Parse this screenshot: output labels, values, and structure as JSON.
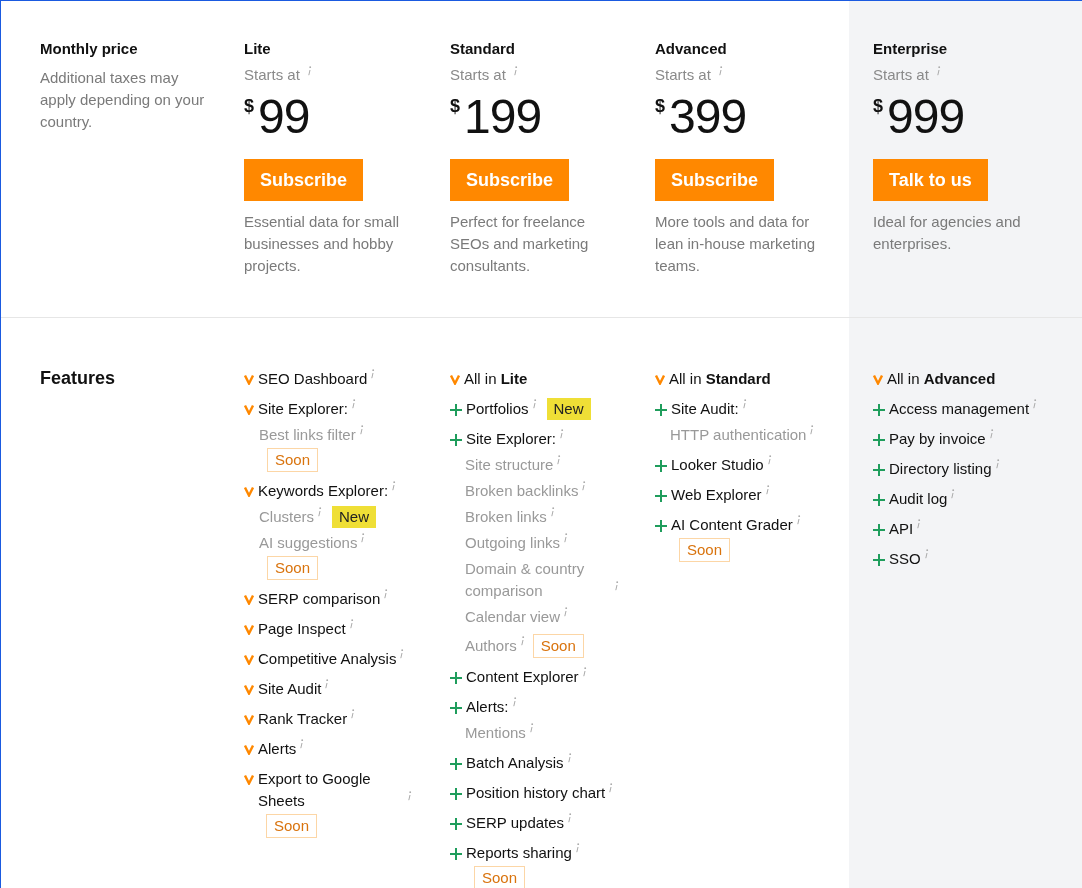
{
  "pricing": {
    "title": "Monthly price",
    "note": "Additional taxes may apply depending on your country.",
    "plans": [
      {
        "name": "Lite",
        "starts_at": "Starts at",
        "currency": "$",
        "price": "99",
        "button": "Subscribe",
        "description": "Essential data for small businesses and hobby projects.",
        "highlighted": false
      },
      {
        "name": "Standard",
        "starts_at": "Starts at",
        "currency": "$",
        "price": "199",
        "button": "Subscribe",
        "description": "Perfect for freelance SEOs and marketing consultants.",
        "highlighted": false
      },
      {
        "name": "Advanced",
        "starts_at": "Starts at",
        "currency": "$",
        "price": "399",
        "button": "Subscribe",
        "description": "More tools and data for lean in-house marketing teams.",
        "highlighted": false
      },
      {
        "name": "Enterprise",
        "starts_at": "Starts at",
        "currency": "$",
        "price": "999",
        "button": "Talk to us",
        "description": "Ideal for agencies and enterprises.",
        "highlighted": true
      }
    ]
  },
  "features": {
    "title": "Features",
    "columns": [
      {
        "items": [
          {
            "kind": "check",
            "label": "SEO Dashboard",
            "info": true
          },
          {
            "kind": "check",
            "label": "Site Explorer:",
            "info": true,
            "children": [
              {
                "label": "Best links filter",
                "info": true,
                "badge": {
                  "kind": "soon",
                  "text": "Soon"
                }
              }
            ]
          },
          {
            "kind": "check",
            "label": "Keywords Explorer:",
            "info": true,
            "children": [
              {
                "label": "Clusters",
                "info": true,
                "badge": {
                  "kind": "new",
                  "text": "New"
                }
              },
              {
                "label": "AI suggestions",
                "info": true,
                "badge": {
                  "kind": "soon",
                  "text": "Soon"
                }
              }
            ]
          },
          {
            "kind": "check",
            "label": "SERP comparison",
            "info": true
          },
          {
            "kind": "check",
            "label": "Page Inspect",
            "info": true
          },
          {
            "kind": "check",
            "label": "Competitive Analysis",
            "info": true
          },
          {
            "kind": "check",
            "label": "Site Audit",
            "info": true
          },
          {
            "kind": "check",
            "label": "Rank Tracker",
            "info": true
          },
          {
            "kind": "check",
            "label": "Alerts",
            "info": true
          },
          {
            "kind": "check",
            "label": "Export to Google Sheets",
            "info": true,
            "badge": {
              "kind": "soon",
              "text": "Soon"
            }
          }
        ]
      },
      {
        "items": [
          {
            "kind": "check",
            "label": "All in **Lite**",
            "info": false
          },
          {
            "kind": "plus",
            "label": "Portfolios",
            "info": true,
            "badge": {
              "kind": "new",
              "text": "New"
            }
          },
          {
            "kind": "plus",
            "label": "Site Explorer:",
            "info": true,
            "children": [
              {
                "label": "Site structure",
                "info": true
              },
              {
                "label": "Broken backlinks",
                "info": true
              },
              {
                "label": "Broken links",
                "info": true
              },
              {
                "label": "Outgoing links",
                "info": true
              },
              {
                "label": "Domain & country comparison",
                "info": true
              },
              {
                "label": "Calendar view",
                "info": true
              },
              {
                "label": "Authors",
                "info": true,
                "badge": {
                  "kind": "soon",
                  "text": "Soon"
                }
              }
            ]
          },
          {
            "kind": "plus",
            "label": "Content Explorer",
            "info": true
          },
          {
            "kind": "plus",
            "label": "Alerts:",
            "info": true,
            "children": [
              {
                "label": "Mentions",
                "info": true
              }
            ]
          },
          {
            "kind": "plus",
            "label": "Batch Analysis",
            "info": true
          },
          {
            "kind": "plus",
            "label": "Position history chart",
            "info": true
          },
          {
            "kind": "plus",
            "label": "SERP updates",
            "info": true
          },
          {
            "kind": "plus",
            "label": "Reports sharing",
            "info": true,
            "badge": {
              "kind": "soon",
              "text": "Soon"
            }
          }
        ]
      },
      {
        "items": [
          {
            "kind": "check",
            "label": "All in **Standard**",
            "info": false
          },
          {
            "kind": "plus",
            "label": "Site Audit:",
            "info": true,
            "children": [
              {
                "label": "HTTP authentication",
                "info": true
              }
            ]
          },
          {
            "kind": "plus",
            "label": "Looker Studio",
            "info": true
          },
          {
            "kind": "plus",
            "label": "Web Explorer",
            "info": true
          },
          {
            "kind": "plus",
            "label": "AI Content Grader",
            "info": true,
            "badge": {
              "kind": "soon",
              "text": "Soon"
            }
          }
        ]
      },
      {
        "items": [
          {
            "kind": "check",
            "label": "All in **Advanced**",
            "info": false
          },
          {
            "kind": "plus",
            "label": "Access management",
            "info": true
          },
          {
            "kind": "plus",
            "label": "Pay by invoice",
            "info": true
          },
          {
            "kind": "plus",
            "label": "Directory listing",
            "info": true
          },
          {
            "kind": "plus",
            "label": "Audit log",
            "info": true
          },
          {
            "kind": "plus",
            "label": "API",
            "info": true
          },
          {
            "kind": "plus",
            "label": "SSO",
            "info": true
          }
        ]
      }
    ]
  }
}
